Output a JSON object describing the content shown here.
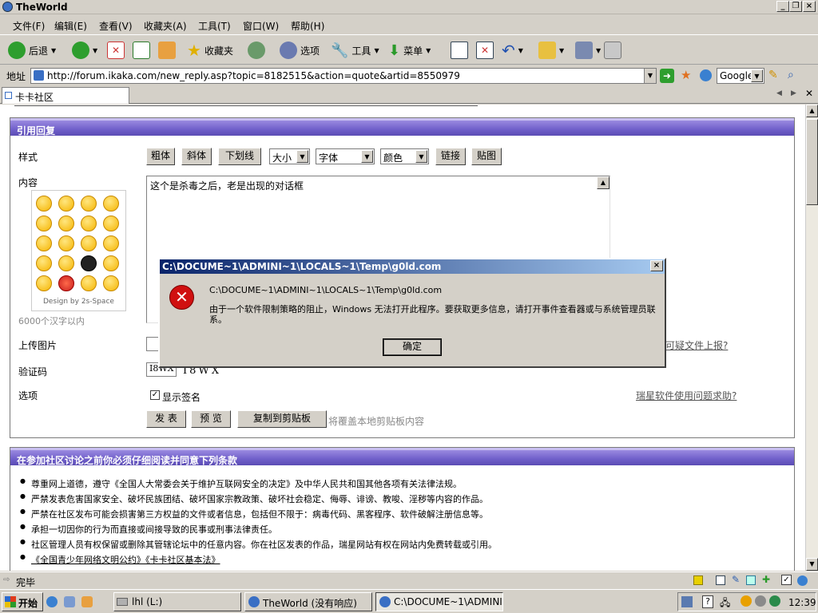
{
  "window": {
    "title": "TheWorld"
  },
  "menu": [
    "文件(F)",
    "编辑(E)",
    "查看(V)",
    "收藏夹(A)",
    "工具(T)",
    "窗口(W)",
    "帮助(H)"
  ],
  "toolbar": {
    "back": "后退",
    "favorites": "收藏夹",
    "options": "选项",
    "tools": "工具",
    "menu": "菜单"
  },
  "address": {
    "label": "地址",
    "url": "http://forum.ikaka.com/new_reply.asp?topic=8182515&action=quote&artid=8550979",
    "search_engine": "Google"
  },
  "tab": {
    "label": "卡卡社区 www.ikaka.com"
  },
  "form": {
    "heading": "引用回复",
    "style_label": "样式",
    "format_buttons": [
      "粗体",
      "斜体",
      "下划线"
    ],
    "size_select": "大小",
    "font_select": "字体",
    "color_select": "颜色",
    "link_button": "链接",
    "image_button": "贴图",
    "content_label": "内容",
    "content_text": "这个是杀毒之后，老是出现的对话框",
    "emoticon_credit": "Design by 2s-Space",
    "limit_note": "6000个汉字以内",
    "upload_label": "上传图片",
    "upload_link": "可疑文件上报?",
    "captcha_label": "验证码",
    "captcha_value": "I8WX",
    "captcha_image": "I8WX",
    "options_label": "选项",
    "show_signature": "显示签名",
    "help_link": "瑞星软件使用问题求助?",
    "submit": "发 表",
    "preview": "预 览",
    "copy": "复制到剪贴板",
    "copy_note": "将覆盖本地剪贴板内容"
  },
  "terms": {
    "heading": "在参加社区讨论之前你必须仔细阅读并同意下列条款",
    "items": [
      "尊重网上道德，遵守《全国人大常委会关于维护互联网安全的决定》及中华人民共和国其他各项有关法律法规。",
      "严禁发表危害国家安全、破坏民族团结、破坏国家宗教政策、破坏社会稳定、侮辱、诽谤、教唆、淫秽等内容的作品。",
      "严禁在社区发布可能会损害第三方权益的文件或者信息，包括但不限于：病毒代码、黑客程序、软件破解注册信息等。",
      "承担一切因你的行为而直接或间接导致的民事或刑事法律责任。",
      "社区管理人员有权保留或删除其管辖论坛中的任意内容。你在社区发表的作品，瑞星网站有权在网站内免费转载或引用。",
      "《全国青少年网络文明公约》《卡卡社区基本法》"
    ]
  },
  "dialog": {
    "title": "C:\\DOCUME~1\\ADMINI~1\\LOCALS~1\\Temp\\g0ld.com",
    "path": "C:\\DOCUME~1\\ADMINI~1\\LOCALS~1\\Temp\\g0ld.com",
    "message": "由于一个软件限制策略的阻止，Windows 无法打开此程序。要获取更多信息，请打开事件查看器或与系统管理员联系。",
    "ok": "确定"
  },
  "status": {
    "text": "完毕"
  },
  "taskbar": {
    "start": "开始",
    "tasks": [
      "lhl (L:)",
      "TheWorld (没有响应)",
      "C:\\DOCUME~1\\ADMINI..."
    ],
    "time": "12:39"
  },
  "colors": {
    "panel_header": "#6f5ec9",
    "dialog_title": "#0a246a",
    "error_red": "#d01010"
  }
}
